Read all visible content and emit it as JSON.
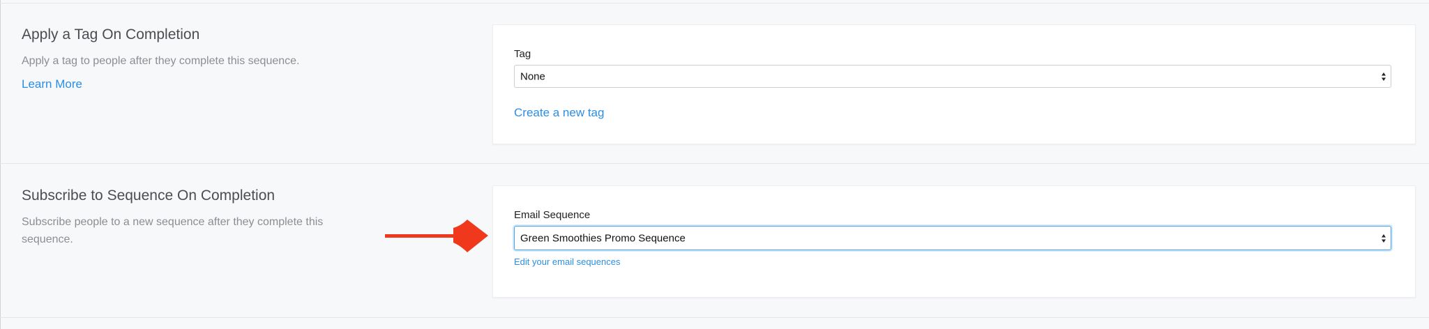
{
  "tag_section": {
    "title": "Apply a Tag On Completion",
    "description": "Apply a tag to people after they complete this sequence.",
    "learn_more": "Learn More",
    "field_label": "Tag",
    "selected_value": "None",
    "create_link": "Create a new tag"
  },
  "sequence_section": {
    "title": "Subscribe to Sequence On Completion",
    "description_line1": "Subscribe people to a new sequence after they complete this",
    "description_line2": "sequence.",
    "field_label": "Email Sequence",
    "selected_value": "Green Smoothies Promo Sequence",
    "edit_link": "Edit your email sequences"
  },
  "colors": {
    "link": "#2a8ee6",
    "annotation_arrow": "#f0391c",
    "focus_border": "#4aa2ef"
  }
}
